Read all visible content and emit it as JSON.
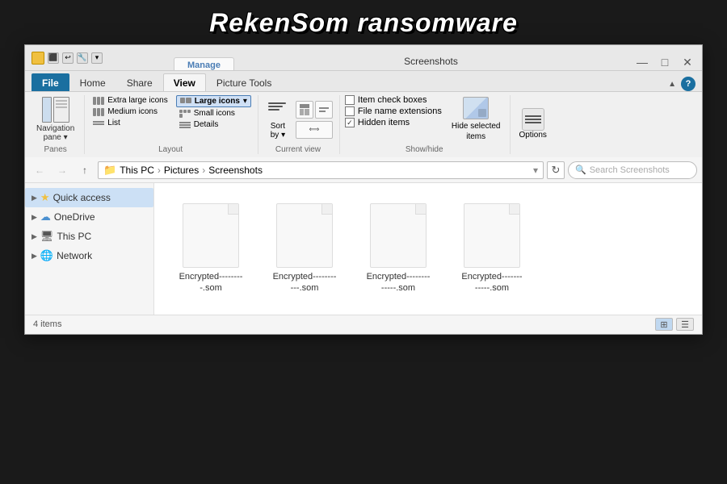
{
  "title_banner": {
    "text": "RekenSom ransomware"
  },
  "window": {
    "title_bar": {
      "manage_label": "Manage",
      "screenshots_label": "Screenshots",
      "icon_label": "folder-icon",
      "minimize_label": "—",
      "maximize_label": "□",
      "close_label": "✕"
    },
    "ribbon": {
      "tabs": [
        {
          "id": "file",
          "label": "File",
          "active": false,
          "is_file": true
        },
        {
          "id": "home",
          "label": "Home",
          "active": false
        },
        {
          "id": "share",
          "label": "Share",
          "active": false
        },
        {
          "id": "view",
          "label": "View",
          "active": true
        },
        {
          "id": "picture_tools",
          "label": "Picture Tools",
          "active": false
        }
      ],
      "panes_group": {
        "label": "Panes",
        "nav_pane_label": "Navigation\npane"
      },
      "layout_group": {
        "label": "Layout",
        "items": [
          {
            "id": "extra_large",
            "label": "Extra large icons",
            "active": false
          },
          {
            "id": "large",
            "label": "Large icons",
            "active": true
          },
          {
            "id": "medium",
            "label": "Medium icons",
            "active": false
          },
          {
            "id": "small",
            "label": "Small icons",
            "active": false
          },
          {
            "id": "list",
            "label": "List",
            "active": false
          },
          {
            "id": "details",
            "label": "Details",
            "active": false
          }
        ]
      },
      "current_view_group": {
        "label": "Current view",
        "sort_by_label": "Sort\nby"
      },
      "show_hide_group": {
        "label": "Show/hide",
        "item_check_boxes_label": "Item check boxes",
        "file_name_extensions_label": "File name extensions",
        "hidden_items_label": "Hidden items",
        "hidden_items_checked": true,
        "hide_selected_label": "Hide selected\nitems",
        "options_label": "Options"
      }
    },
    "address_bar": {
      "path_parts": [
        "This PC",
        "Pictures",
        "Screenshots"
      ],
      "search_placeholder": "Search Screenshots"
    },
    "sidebar": {
      "items": [
        {
          "id": "quick_access",
          "label": "Quick access",
          "icon": "★",
          "icon_class": "star"
        },
        {
          "id": "onedrive",
          "label": "OneDrive",
          "icon": "☁",
          "icon_class": "cloud"
        },
        {
          "id": "this_pc",
          "label": "This PC",
          "icon": "💻",
          "icon_class": "pc"
        },
        {
          "id": "network",
          "label": "Network",
          "icon": "🌐",
          "icon_class": "network"
        }
      ]
    },
    "files": [
      {
        "id": "file1",
        "name": "Encrypted---------.som"
      },
      {
        "id": "file2",
        "name": "Encrypted---------..som"
      },
      {
        "id": "file3",
        "name": "Encrypted----------.som"
      },
      {
        "id": "file4",
        "name": "Encrypted----------.som"
      }
    ],
    "file_display": [
      {
        "line1": "Encrypted--------",
        "line2": "-.som"
      },
      {
        "line1": "Encrypted--------",
        "line2": "---.som"
      },
      {
        "line1": "Encrypted--------",
        "line2": "-----.som"
      },
      {
        "line1": "Encrypted-------",
        "line2": "-----.som"
      }
    ],
    "status_bar": {
      "count_label": "4 items"
    }
  }
}
